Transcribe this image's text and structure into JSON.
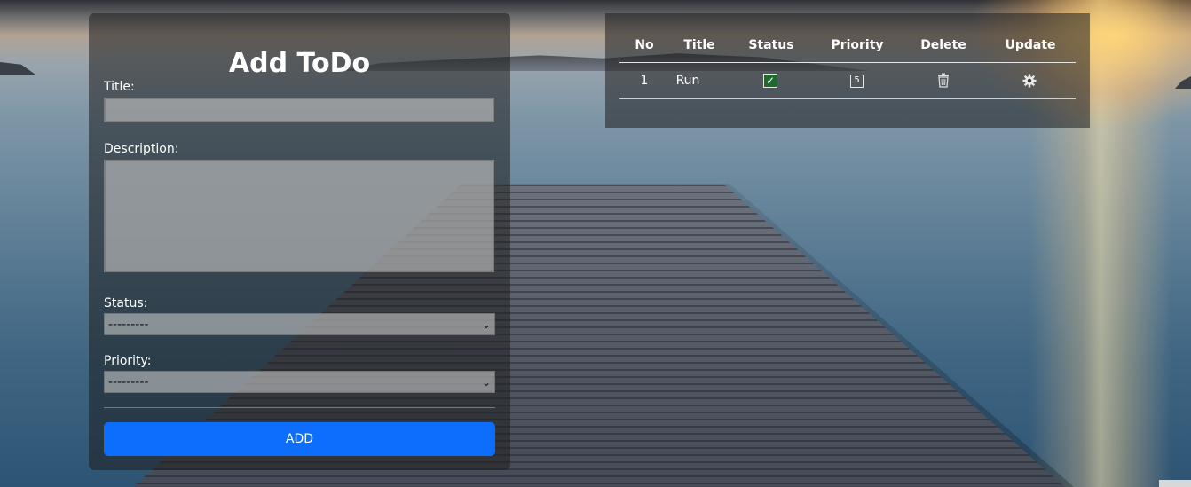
{
  "form": {
    "title": "Add ToDo",
    "title_label": "Title:",
    "title_value": "",
    "description_label": "Description:",
    "description_value": "",
    "status_label": "Status:",
    "status_selected": "---------",
    "priority_label": "Priority:",
    "priority_selected": "---------",
    "add_button": "ADD"
  },
  "table": {
    "headers": [
      "No",
      "Title",
      "Status",
      "Priority",
      "Delete",
      "Update"
    ],
    "rows": [
      {
        "no": "1",
        "title": "Run",
        "status_icon": "checkbox-checked-icon",
        "priority": "5",
        "delete_icon": "trash-icon",
        "update_icon": "gear-icon"
      }
    ]
  },
  "colors": {
    "accent": "#0d6efd",
    "status_checked": "#1f6b2d"
  }
}
